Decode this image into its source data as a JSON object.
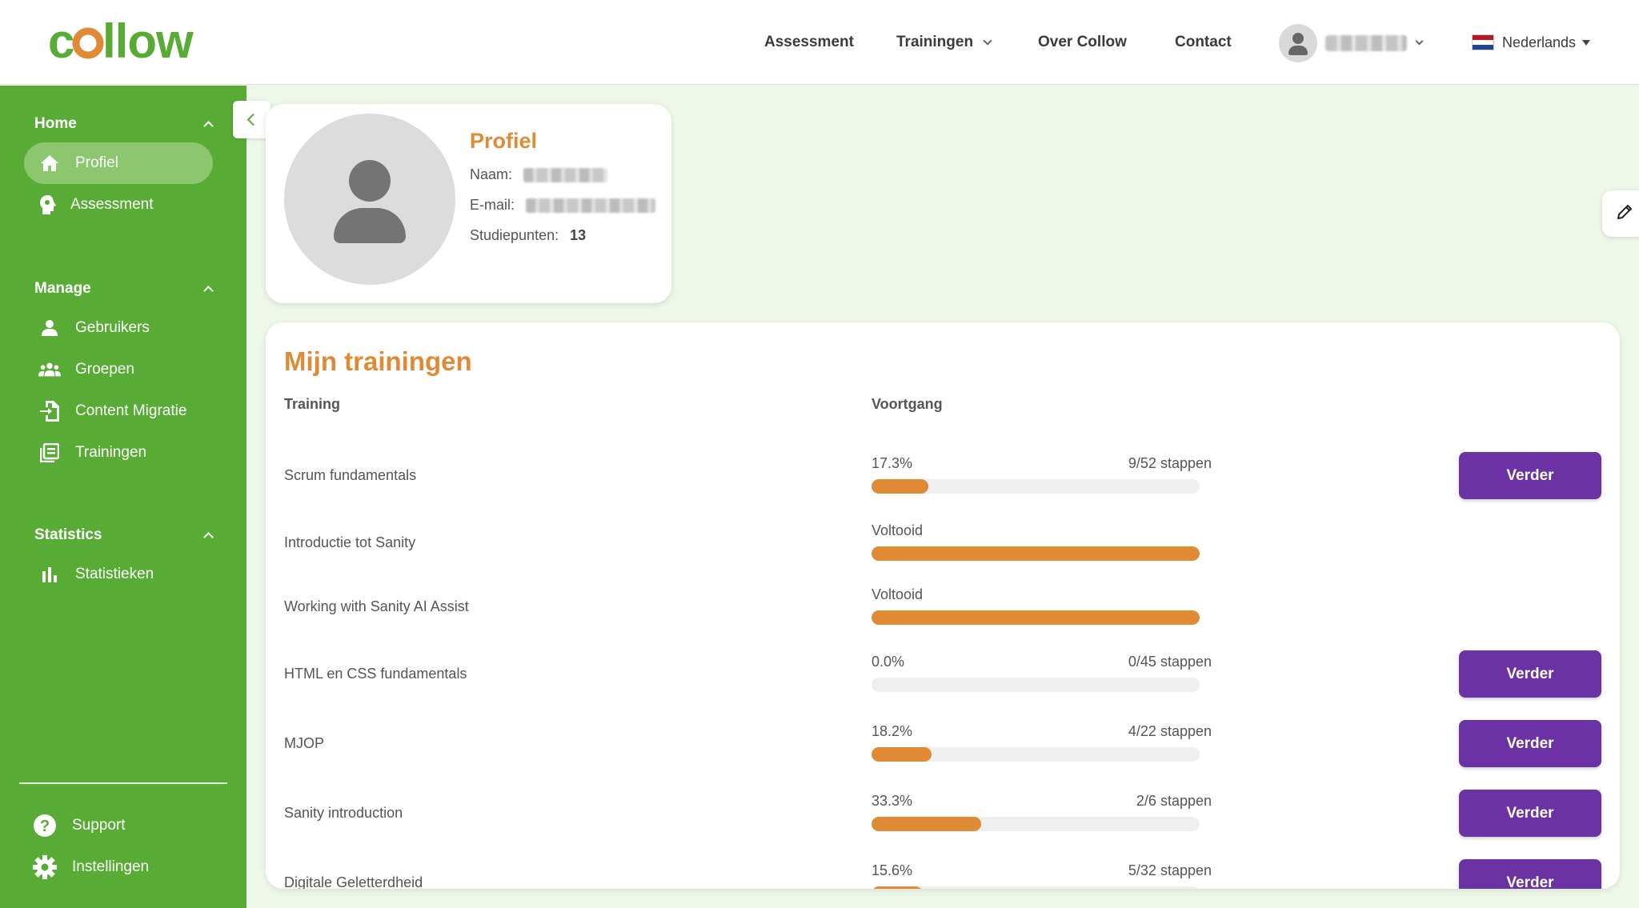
{
  "brand": {
    "logo_text": "collow"
  },
  "header": {
    "nav": [
      {
        "label": "Assessment"
      },
      {
        "label": "Trainingen",
        "has_dropdown": true
      },
      {
        "label": "Over Collow"
      },
      {
        "label": "Contact"
      }
    ],
    "language": "Nederlands"
  },
  "sidebar": {
    "sections": [
      {
        "title": "Home",
        "items": [
          {
            "label": "Profiel",
            "icon": "home-icon",
            "active": true
          },
          {
            "label": "Assessment",
            "icon": "brain-icon"
          }
        ]
      },
      {
        "title": "Manage",
        "items": [
          {
            "label": "Gebruikers",
            "icon": "user-icon"
          },
          {
            "label": "Groepen",
            "icon": "group-icon"
          },
          {
            "label": "Content Migratie",
            "icon": "file-import-icon"
          },
          {
            "label": "Trainingen",
            "icon": "list-icon"
          }
        ]
      },
      {
        "title": "Statistics",
        "items": [
          {
            "label": "Statistieken",
            "icon": "bar-chart-icon"
          }
        ]
      }
    ],
    "bottom": [
      {
        "label": "Support",
        "icon": "help-icon"
      },
      {
        "label": "Instellingen",
        "icon": "gear-icon"
      }
    ]
  },
  "profile": {
    "title": "Profiel",
    "name_label": "Naam:",
    "email_label": "E-mail:",
    "points_label": "Studiepunten:",
    "points_value": "13"
  },
  "trainings": {
    "title": "Mijn trainingen",
    "col_training": "Training",
    "col_progress": "Voortgang",
    "button_label": "Verder",
    "rows": [
      {
        "name": "Scrum fundamentals",
        "label": "17.3%",
        "steps": "9/52 stappen",
        "progress": 0.173,
        "has_button": true
      },
      {
        "name": "Introductie tot Sanity",
        "label": "Voltooid",
        "steps": "",
        "progress": 1.0,
        "has_button": false
      },
      {
        "name": "Working with Sanity AI Assist",
        "label": "Voltooid",
        "steps": "",
        "progress": 1.0,
        "has_button": false
      },
      {
        "name": "HTML en CSS fundamentals",
        "label": "0.0%",
        "steps": "0/45 stappen",
        "progress": 0.0,
        "has_button": true
      },
      {
        "name": "MJOP",
        "label": "18.2%",
        "steps": "4/22 stappen",
        "progress": 0.182,
        "has_button": true
      },
      {
        "name": "Sanity introduction",
        "label": "33.3%",
        "steps": "2/6 stappen",
        "progress": 0.333,
        "has_button": true
      },
      {
        "name": "Digitale Geletterdheid",
        "label": "15.6%",
        "steps": "5/32 stappen",
        "progress": 0.156,
        "has_button": true
      }
    ]
  },
  "colors": {
    "brand_green": "#58ac35",
    "accent_orange": "#e08a35",
    "button_purple": "#6b32a3"
  }
}
